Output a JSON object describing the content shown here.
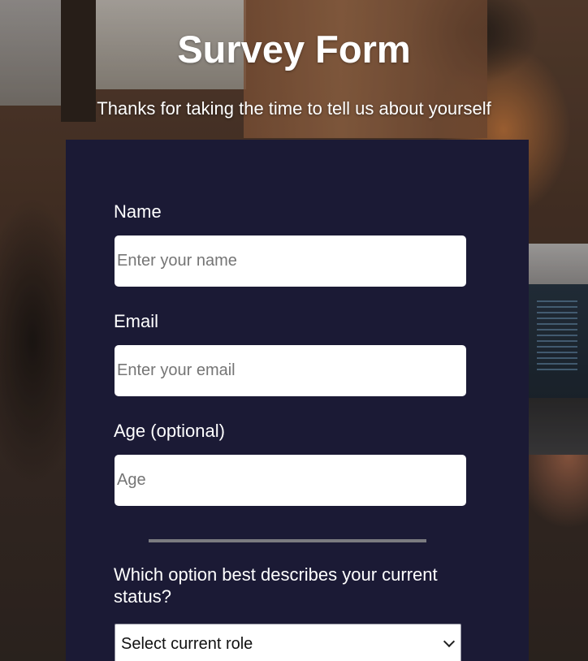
{
  "header": {
    "title": "Survey Form",
    "description": "Thanks for taking the time to tell us about yourself"
  },
  "form": {
    "name": {
      "label": "Name",
      "placeholder": "Enter your name",
      "value": ""
    },
    "email": {
      "label": "Email",
      "placeholder": "Enter your email",
      "value": ""
    },
    "age": {
      "label": "Age (optional)",
      "placeholder": "Age",
      "value": ""
    },
    "status": {
      "question": "Which option best describes your current status?",
      "selected": "Select current role",
      "icon": "chevron-down-icon"
    }
  },
  "colors": {
    "card_background": "#1b1a35",
    "text": "#ffffff",
    "divider": "#7b7b80"
  }
}
